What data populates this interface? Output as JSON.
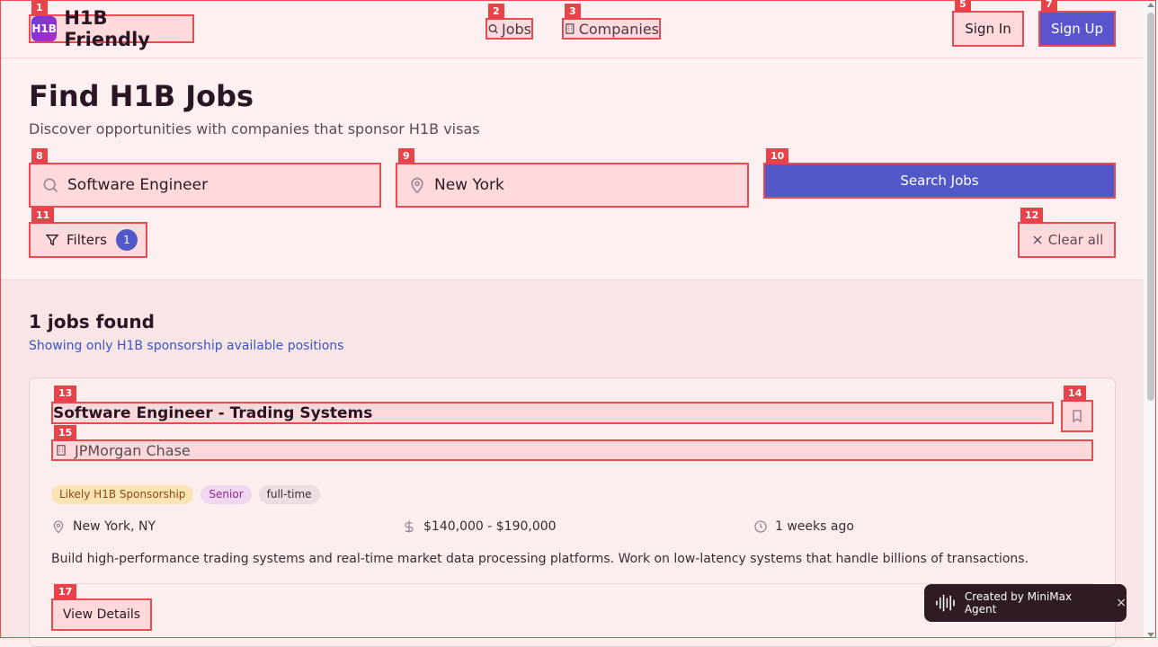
{
  "brand": {
    "mark": "H1B",
    "name": "H1B Friendly"
  },
  "nav": {
    "jobs": "Jobs",
    "companies": "Companies",
    "sign_in": "Sign In",
    "sign_up": "Sign Up"
  },
  "hero": {
    "title": "Find H1B Jobs",
    "subtitle": "Discover opportunities with companies that sponsor H1B visas",
    "keyword_value": "Software Engineer",
    "location_value": "New York",
    "search_label": "Search Jobs",
    "filters_label": "Filters",
    "filters_count": "1",
    "clear_label": "Clear all"
  },
  "results": {
    "count_text": "1 jobs found",
    "note": "Showing only H1B sponsorship available positions",
    "jobs": [
      {
        "title": "Software Engineer - Trading Systems",
        "company": "JPMorgan Chase",
        "tags": [
          "Likely H1B Sponsorship",
          "Senior",
          "full-time"
        ],
        "location": "New York, NY",
        "salary": "$140,000 - $190,000",
        "posted": "1 weeks ago",
        "description": "Build high-performance trading systems and real-time market data processing platforms. Work on low-latency systems that handle billions of transactions.",
        "view_label": "View Details"
      }
    ]
  },
  "toast": {
    "text": "Created by MiniMax Agent",
    "close": "×"
  },
  "overlay_tags": [
    "1",
    "2",
    "3",
    "5",
    "7",
    "8",
    "9",
    "10",
    "11",
    "12",
    "13",
    "14",
    "15",
    "17"
  ],
  "colors": {
    "accent": "#5258c8",
    "highlight": "#ea4a52",
    "page_bg": "#fdeeee"
  }
}
